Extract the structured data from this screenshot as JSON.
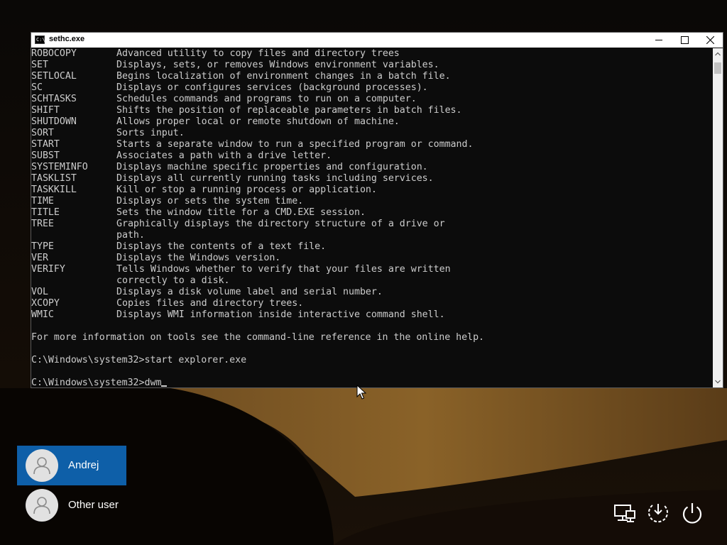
{
  "window": {
    "title": "sethc.exe",
    "icon_label": "C:\\",
    "buttons": [
      "minimize-icon",
      "maximize-icon",
      "close-icon"
    ]
  },
  "console": {
    "commands": [
      {
        "name": "ROBOCOPY",
        "desc": "Advanced utility to copy files and directory trees"
      },
      {
        "name": "SET",
        "desc": "Displays, sets, or removes Windows environment variables."
      },
      {
        "name": "SETLOCAL",
        "desc": "Begins localization of environment changes in a batch file."
      },
      {
        "name": "SC",
        "desc": "Displays or configures services (background processes)."
      },
      {
        "name": "SCHTASKS",
        "desc": "Schedules commands and programs to run on a computer."
      },
      {
        "name": "SHIFT",
        "desc": "Shifts the position of replaceable parameters in batch files."
      },
      {
        "name": "SHUTDOWN",
        "desc": "Allows proper local or remote shutdown of machine."
      },
      {
        "name": "SORT",
        "desc": "Sorts input."
      },
      {
        "name": "START",
        "desc": "Starts a separate window to run a specified program or command."
      },
      {
        "name": "SUBST",
        "desc": "Associates a path with a drive letter."
      },
      {
        "name": "SYSTEMINFO",
        "desc": "Displays machine specific properties and configuration."
      },
      {
        "name": "TASKLIST",
        "desc": "Displays all currently running tasks including services."
      },
      {
        "name": "TASKKILL",
        "desc": "Kill or stop a running process or application."
      },
      {
        "name": "TIME",
        "desc": "Displays or sets the system time."
      },
      {
        "name": "TITLE",
        "desc": "Sets the window title for a CMD.EXE session."
      },
      {
        "name": "TREE",
        "desc": "Graphically displays the directory structure of a drive or"
      },
      {
        "name": "",
        "desc": "path."
      },
      {
        "name": "TYPE",
        "desc": "Displays the contents of a text file."
      },
      {
        "name": "VER",
        "desc": "Displays the Windows version."
      },
      {
        "name": "VERIFY",
        "desc": "Tells Windows whether to verify that your files are written"
      },
      {
        "name": "",
        "desc": "correctly to a disk."
      },
      {
        "name": "VOL",
        "desc": "Displays a disk volume label and serial number."
      },
      {
        "name": "XCOPY",
        "desc": "Copies files and directory trees."
      },
      {
        "name": "WMIC",
        "desc": "Displays WMI information inside interactive command shell."
      }
    ],
    "footer": "For more information on tools see the command-line reference in the online help.",
    "history_prompt": "C:\\Windows\\system32>start explorer.exe",
    "current_prompt": "C:\\Windows\\system32>",
    "current_input": "dwm"
  },
  "users": [
    {
      "name": "Andrej",
      "selected": true
    },
    {
      "name": "Other user",
      "selected": false
    }
  ],
  "system_icons": [
    "network-icon",
    "ease-of-access-icon",
    "power-icon"
  ],
  "colors": {
    "console_bg": "#0c0c0c",
    "console_text": "#cccccc",
    "selected_user": "#0e5fa8"
  }
}
